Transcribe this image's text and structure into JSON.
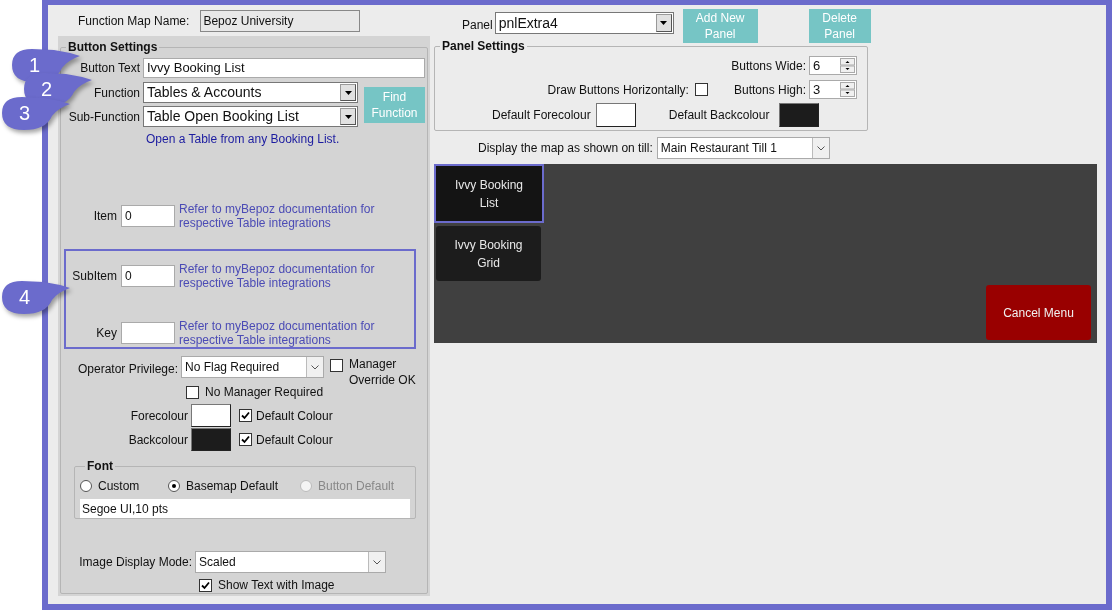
{
  "function_map_name": {
    "label": "Function Map Name:",
    "value": "Bepoz University"
  },
  "button_settings": {
    "title": "Button Settings",
    "button_text": {
      "label": "Button Text",
      "value": "Ivvy Booking List"
    },
    "function": {
      "label": "Function",
      "value": "Tables & Accounts"
    },
    "sub_function": {
      "label": "Sub-Function",
      "value": "Table Open Booking List"
    },
    "find_function_button": "Find Function",
    "description": "Open a Table from any Booking List.",
    "params": [
      {
        "label": "Item",
        "value": "0",
        "note": "Refer to myBepoz documentation for respective Table integrations",
        "highlighted": false
      },
      {
        "label": "SubItem",
        "value": "0",
        "note": "Refer to myBepoz documentation for respective Table integrations",
        "highlighted": true
      },
      {
        "label": "Key",
        "note": "Refer to myBepoz documentation for respective Table integrations",
        "highlighted": true
      }
    ],
    "operator_privilege": {
      "label": "Operator Privilege:",
      "value": "No Flag Required"
    },
    "manager_override": {
      "label": "Manager Override OK",
      "checked": false
    },
    "no_manager_required": {
      "label": "No Manager Required",
      "checked": false
    },
    "colours": [
      {
        "label": "Forecolour",
        "color": "#ffffff",
        "default_label": "Default Colour",
        "checked": true
      },
      {
        "label": "Backcolour",
        "color": "#1c1c1c",
        "default_label": "Default Colour",
        "checked": true
      }
    ],
    "font": {
      "title": "Font",
      "options": [
        {
          "label": "Custom",
          "selected": false,
          "disabled": false
        },
        {
          "label": "Basemap Default",
          "selected": true,
          "disabled": false
        },
        {
          "label": "Button Default",
          "selected": false,
          "disabled": true
        }
      ],
      "value": "Segoe UI,10 pts"
    },
    "image_display_mode": {
      "label": "Image Display Mode:",
      "value": "Scaled"
    },
    "show_text_with_image": {
      "label": "Show Text with Image",
      "checked": true
    }
  },
  "panel": {
    "label": "Panel",
    "value": "pnlExtra4"
  },
  "panel_buttons": [
    "Add New Panel",
    "Delete Panel"
  ],
  "panel_settings": {
    "title": "Panel Settings",
    "buttons_wide": {
      "label": "Buttons Wide:",
      "value": "6"
    },
    "draw_horizontally": {
      "label": "Draw Buttons Horizontally:",
      "checked": false
    },
    "buttons_high": {
      "label": "Buttons High:",
      "value": "3"
    },
    "default_forecolour": {
      "label": "Default Forecolour",
      "color": "#ffffff"
    },
    "default_backcolour": {
      "label": "Default Backcolour",
      "color": "#1c1c1c"
    }
  },
  "till": {
    "label": "Display the map as shown on till:",
    "value": "Main Restaurant Till 1"
  },
  "map_buttons": [
    {
      "label": "Ivvy Booking List",
      "selected": true
    },
    {
      "label": "Ivvy Booking Grid",
      "selected": false
    }
  ],
  "cancel_button": "Cancel Menu",
  "callouts": [
    "1",
    "2",
    "3",
    "4"
  ]
}
